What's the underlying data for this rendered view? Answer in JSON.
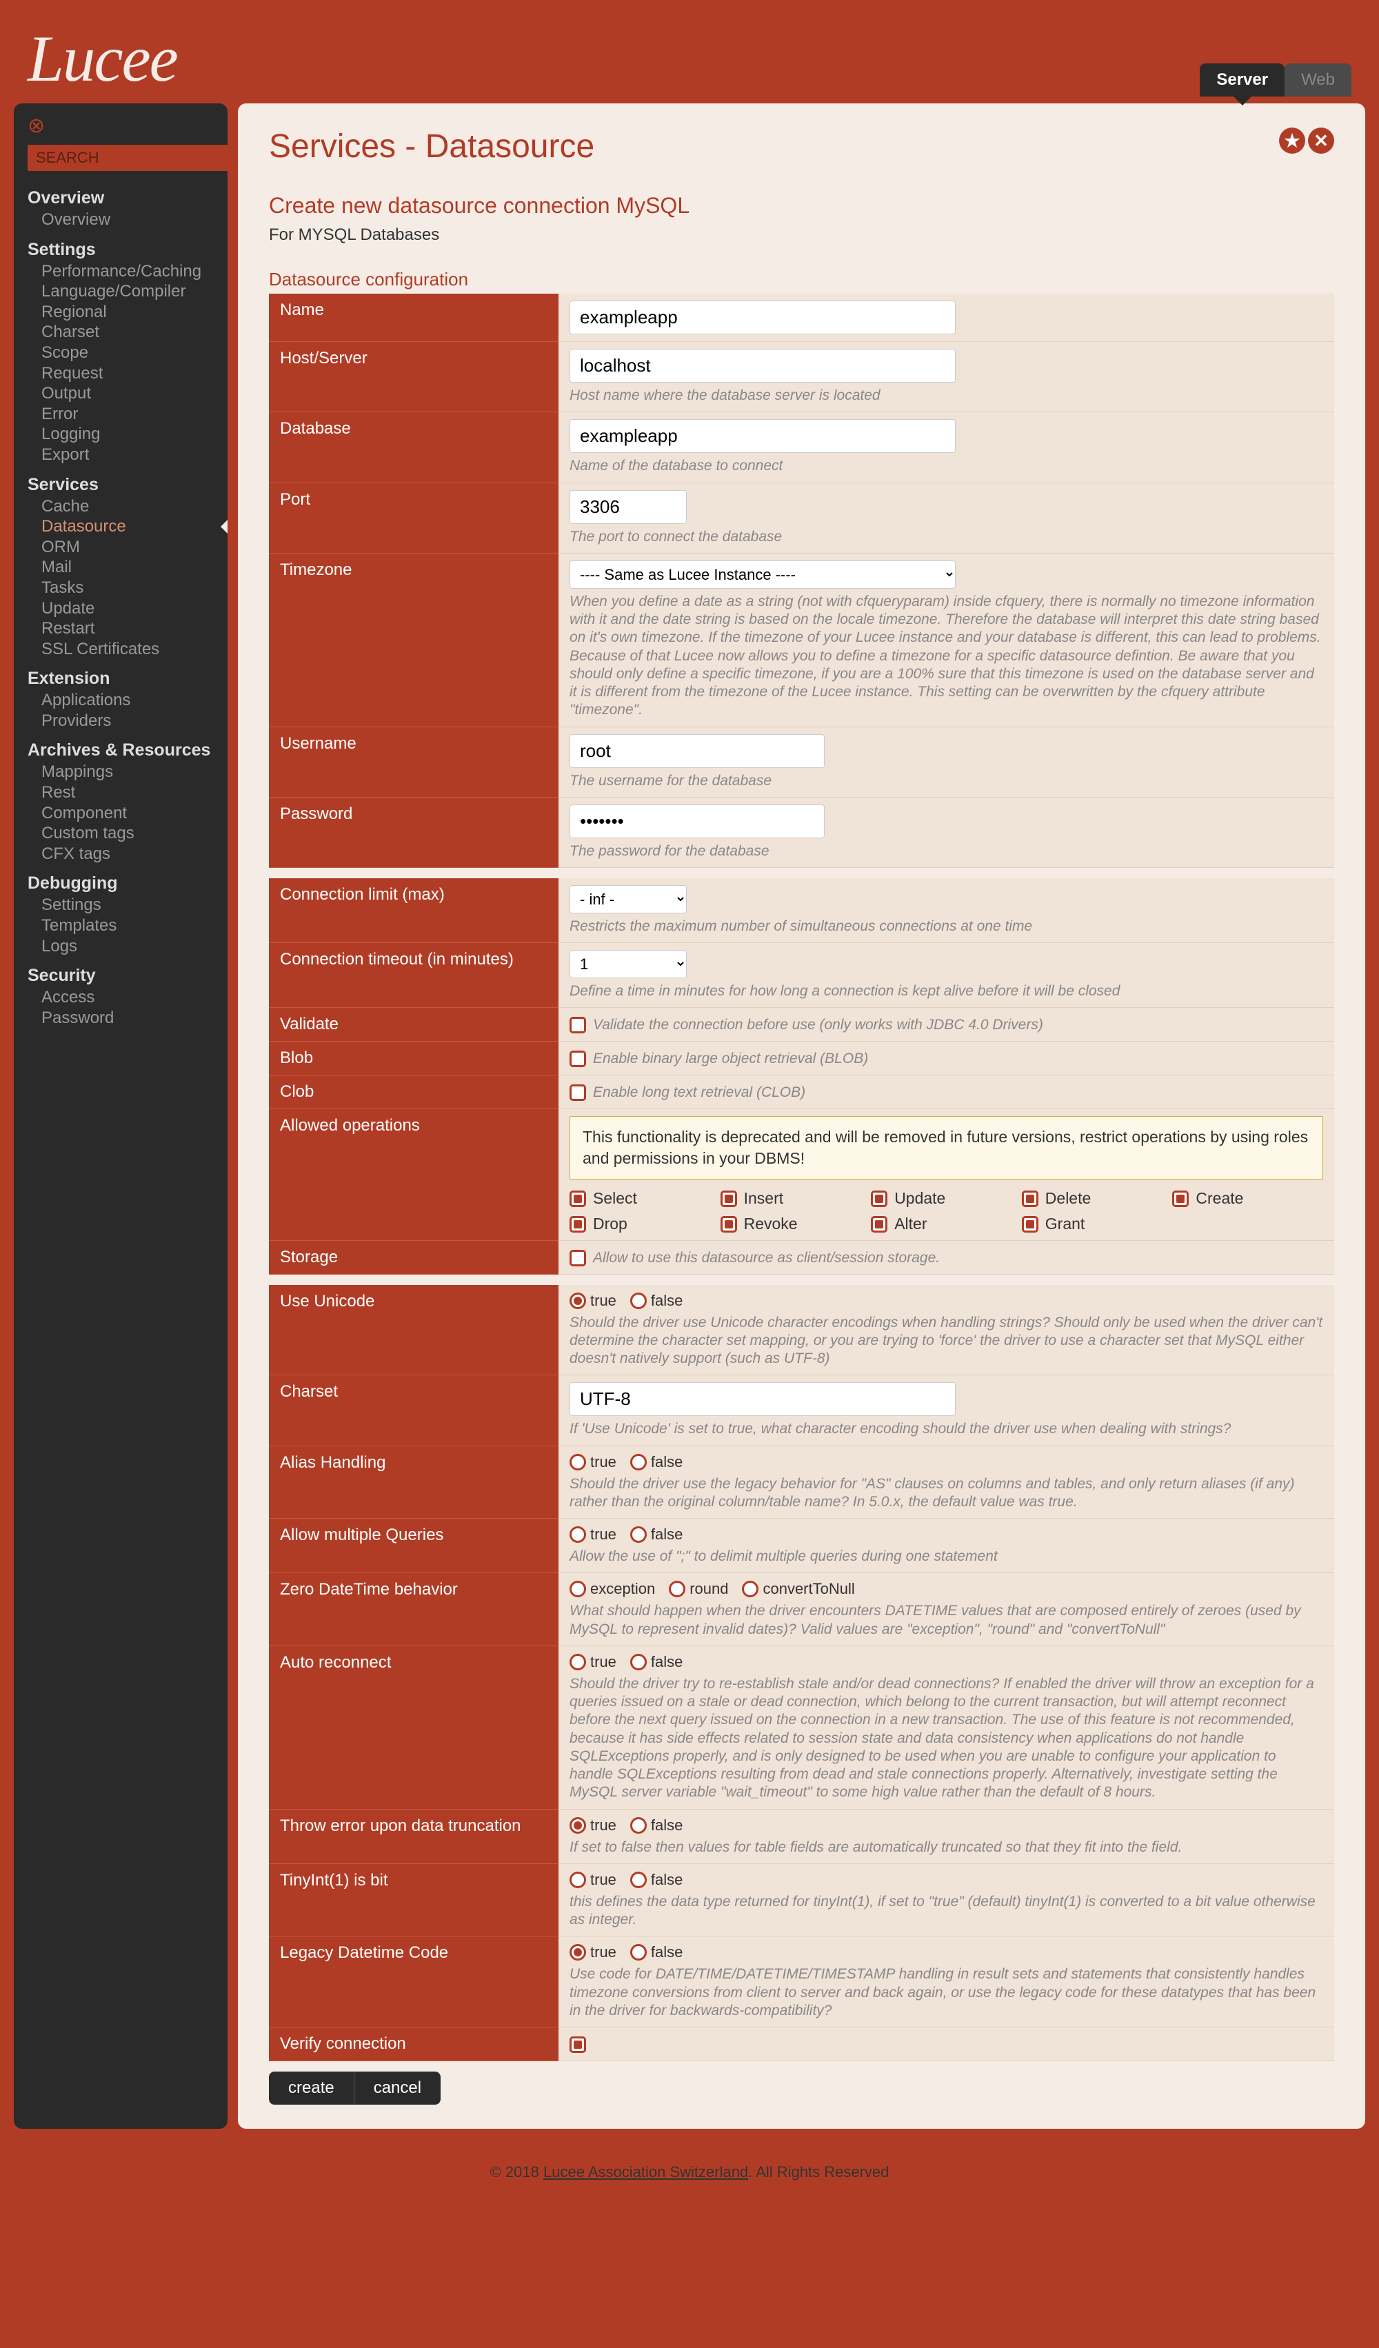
{
  "header": {
    "logo": "Lucee",
    "tabs": [
      "Server",
      "Web"
    ],
    "activeTab": 0
  },
  "search": {
    "placeholder": "SEARCH"
  },
  "nav": [
    {
      "head": "Overview",
      "items": [
        "Overview"
      ]
    },
    {
      "head": "Settings",
      "items": [
        "Performance/Caching",
        "Language/Compiler",
        "Regional",
        "Charset",
        "Scope",
        "Request",
        "Output",
        "Error",
        "Logging",
        "Export"
      ]
    },
    {
      "head": "Services",
      "items": [
        "Cache",
        "Datasource",
        "ORM",
        "Mail",
        "Tasks",
        "Update",
        "Restart",
        "SSL Certificates"
      ],
      "active": 1
    },
    {
      "head": "Extension",
      "items": [
        "Applications",
        "Providers"
      ]
    },
    {
      "head": "Archives & Resources",
      "items": [
        "Mappings",
        "Rest",
        "Component",
        "Custom tags",
        "CFX tags"
      ]
    },
    {
      "head": "Debugging",
      "items": [
        "Settings",
        "Templates",
        "Logs"
      ]
    },
    {
      "head": "Security",
      "items": [
        "Access",
        "Password"
      ]
    }
  ],
  "page": {
    "title": "Services - Datasource",
    "subtitle": "Create new datasource connection MySQL",
    "description": "For MYSQL Databases",
    "section": "Datasource configuration"
  },
  "rows": {
    "name": {
      "label": "Name",
      "value": "exampleapp"
    },
    "host": {
      "label": "Host/Server",
      "value": "localhost",
      "hint": "Host name where the database server is located"
    },
    "database": {
      "label": "Database",
      "value": "exampleapp",
      "hint": "Name of the database to connect"
    },
    "port": {
      "label": "Port",
      "value": "3306",
      "hint": "The port to connect the database"
    },
    "timezone": {
      "label": "Timezone",
      "value": "---- Same as Lucee Instance ----",
      "hint": "When you define a date as a string (not with cfqueryparam) inside cfquery, there is normally no timezone information with it and the date string is based on the locale timezone. Therefore the database will interpret this date string based on it's own timezone. If the timezone of your Lucee instance and your database is different, this can lead to problems. Because of that Lucee now allows you to define a timezone for a specific datasource defintion. Be aware that you should only define a specific timezone, if you are a 100% sure that this timezone is used on the database server and it is different from the timezone of the Lucee instance. This setting can be overwritten by the cfquery attribute \"timezone\"."
    },
    "username": {
      "label": "Username",
      "value": "root",
      "hint": "The username for the database"
    },
    "password": {
      "label": "Password",
      "value": "•••••••",
      "hint": "The password for the database"
    },
    "connLimit": {
      "label": "Connection limit (max)",
      "value": "- inf -",
      "hint": "Restricts the maximum number of simultaneous connections at one time"
    },
    "connTimeout": {
      "label": "Connection timeout (in minutes)",
      "value": "1",
      "hint": "Define a time in minutes for how long a connection is kept alive before it will be closed"
    },
    "validate": {
      "label": "Validate",
      "hint": "Validate the connection before use (only works with JDBC 4.0 Drivers)"
    },
    "blob": {
      "label": "Blob",
      "hint": "Enable binary large object retrieval (BLOB)"
    },
    "clob": {
      "label": "Clob",
      "hint": "Enable long text retrieval (CLOB)"
    },
    "allowed": {
      "label": "Allowed operations",
      "warning": "This functionality is deprecated and will be removed in future versions, restrict operations by using roles and permissions in your DBMS!",
      "ops": [
        "Select",
        "Insert",
        "Update",
        "Delete",
        "Create",
        "Drop",
        "Revoke",
        "Alter",
        "Grant"
      ]
    },
    "storage": {
      "label": "Storage",
      "hint": "Allow to use this datasource as client/session storage."
    },
    "unicode": {
      "label": "Use Unicode",
      "hint": "Should the driver use Unicode character encodings when handling strings? Should only be used when the driver can't determine the character set mapping, or you are trying to 'force' the driver to use a character set that MySQL either doesn't natively support (such as UTF-8)"
    },
    "charset": {
      "label": "Charset",
      "value": "UTF-8",
      "hint": "If 'Use Unicode' is set to true, what character encoding should the driver use when dealing with strings?"
    },
    "alias": {
      "label": "Alias Handling",
      "hint": "Should the driver use the legacy behavior for \"AS\" clauses on columns and tables, and only return aliases (if any) rather than the original column/table name? In 5.0.x, the default value was true."
    },
    "multi": {
      "label": "Allow multiple Queries",
      "hint": "Allow the use of \";\" to delimit multiple queries during one statement"
    },
    "zero": {
      "label": "Zero DateTime behavior",
      "opts": [
        "exception",
        "round",
        "convertToNull"
      ],
      "hint": "What should happen when the driver encounters DATETIME values that are composed entirely of zeroes (used by MySQL to represent invalid dates)? Valid values are \"exception\", \"round\" and \"convertToNull\""
    },
    "auto": {
      "label": "Auto reconnect",
      "hint": "Should the driver try to re-establish stale and/or dead connections? If enabled the driver will throw an exception for a queries issued on a stale or dead connection, which belong to the current transaction, but will attempt reconnect before the next query issued on the connection in a new transaction. The use of this feature is not recommended, because it has side effects related to session state and data consistency when applications do not handle SQLExceptions properly, and is only designed to be used when you are unable to configure your application to handle SQLExceptions resulting from dead and stale connections properly. Alternatively, investigate setting the MySQL server variable \"wait_timeout\" to some high value rather than the default of 8 hours."
    },
    "trunc": {
      "label": "Throw error upon data truncation",
      "hint": "If set to false then values for table fields are automatically truncated so that they fit into the field."
    },
    "tiny": {
      "label": "TinyInt(1) is bit",
      "hint": "this defines the data type returned for tinyInt(1), if set to \"true\" (default) tinyInt(1) is converted to a bit value otherwise as integer."
    },
    "legacy": {
      "label": "Legacy Datetime Code",
      "hint": "Use code for DATE/TIME/DATETIME/TIMESTAMP handling in result sets and statements that consistently handles timezone conversions from client to server and back again, or use the legacy code for these datatypes that has been in the driver for backwards-compatibility?"
    },
    "verify": {
      "label": "Verify connection"
    }
  },
  "tf": {
    "t": "true",
    "f": "false"
  },
  "buttons": {
    "create": "create",
    "cancel": "cancel"
  },
  "footer": {
    "copy": "© 2018 ",
    "org": "Lucee Association Switzerland",
    "rest": ". All Rights Reserved"
  }
}
